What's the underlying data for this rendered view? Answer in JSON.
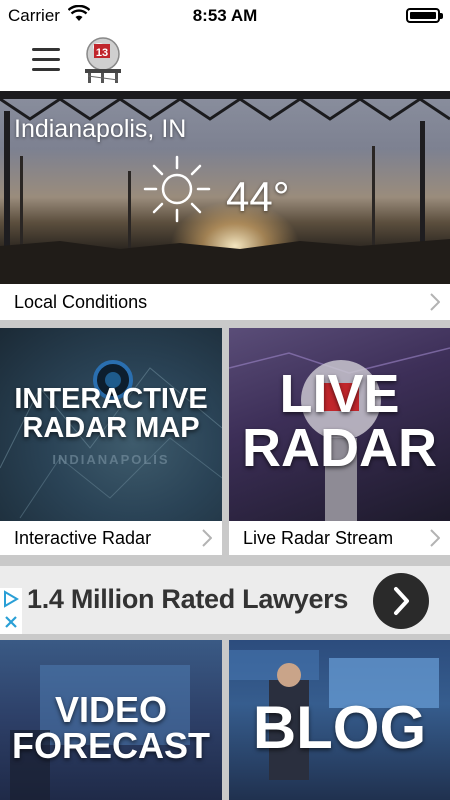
{
  "status_bar": {
    "carrier": "Carrier",
    "time": "8:53 AM"
  },
  "hero": {
    "city": "Indianapolis, IN",
    "temperature": "44°",
    "condition_icon": "sun-icon"
  },
  "local_conditions": {
    "label": "Local Conditions"
  },
  "tiles": [
    {
      "overlay": "INTERACTIVE RADAR MAP",
      "line1": "INTERACTIVE",
      "line2": "RADAR MAP",
      "sub": "INDIANAPOLIS",
      "label": "Interactive Radar"
    },
    {
      "overlay": "LIVE RADAR",
      "line1": "LIVE",
      "line2": "RADAR",
      "label": "Live Radar Stream"
    },
    {
      "line1": "VIDEO",
      "line2": "FORECAST"
    },
    {
      "line1": "BLOG"
    }
  ],
  "ad": {
    "text": "1.4 Million Rated Lawyers"
  }
}
